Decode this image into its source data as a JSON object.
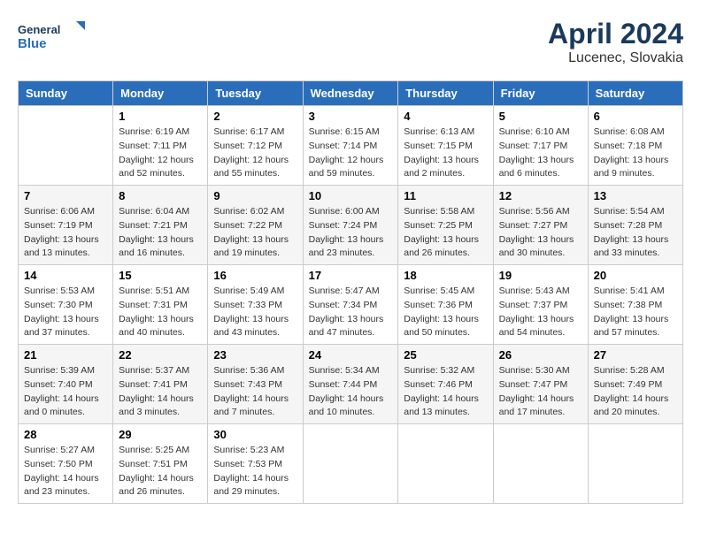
{
  "header": {
    "logo_line1": "General",
    "logo_line2": "Blue",
    "month": "April 2024",
    "location": "Lucenec, Slovakia"
  },
  "weekdays": [
    "Sunday",
    "Monday",
    "Tuesday",
    "Wednesday",
    "Thursday",
    "Friday",
    "Saturday"
  ],
  "weeks": [
    [
      {
        "day": "",
        "info": ""
      },
      {
        "day": "1",
        "info": "Sunrise: 6:19 AM\nSunset: 7:11 PM\nDaylight: 12 hours\nand 52 minutes."
      },
      {
        "day": "2",
        "info": "Sunrise: 6:17 AM\nSunset: 7:12 PM\nDaylight: 12 hours\nand 55 minutes."
      },
      {
        "day": "3",
        "info": "Sunrise: 6:15 AM\nSunset: 7:14 PM\nDaylight: 12 hours\nand 59 minutes."
      },
      {
        "day": "4",
        "info": "Sunrise: 6:13 AM\nSunset: 7:15 PM\nDaylight: 13 hours\nand 2 minutes."
      },
      {
        "day": "5",
        "info": "Sunrise: 6:10 AM\nSunset: 7:17 PM\nDaylight: 13 hours\nand 6 minutes."
      },
      {
        "day": "6",
        "info": "Sunrise: 6:08 AM\nSunset: 7:18 PM\nDaylight: 13 hours\nand 9 minutes."
      }
    ],
    [
      {
        "day": "7",
        "info": "Sunrise: 6:06 AM\nSunset: 7:19 PM\nDaylight: 13 hours\nand 13 minutes."
      },
      {
        "day": "8",
        "info": "Sunrise: 6:04 AM\nSunset: 7:21 PM\nDaylight: 13 hours\nand 16 minutes."
      },
      {
        "day": "9",
        "info": "Sunrise: 6:02 AM\nSunset: 7:22 PM\nDaylight: 13 hours\nand 19 minutes."
      },
      {
        "day": "10",
        "info": "Sunrise: 6:00 AM\nSunset: 7:24 PM\nDaylight: 13 hours\nand 23 minutes."
      },
      {
        "day": "11",
        "info": "Sunrise: 5:58 AM\nSunset: 7:25 PM\nDaylight: 13 hours\nand 26 minutes."
      },
      {
        "day": "12",
        "info": "Sunrise: 5:56 AM\nSunset: 7:27 PM\nDaylight: 13 hours\nand 30 minutes."
      },
      {
        "day": "13",
        "info": "Sunrise: 5:54 AM\nSunset: 7:28 PM\nDaylight: 13 hours\nand 33 minutes."
      }
    ],
    [
      {
        "day": "14",
        "info": "Sunrise: 5:53 AM\nSunset: 7:30 PM\nDaylight: 13 hours\nand 37 minutes."
      },
      {
        "day": "15",
        "info": "Sunrise: 5:51 AM\nSunset: 7:31 PM\nDaylight: 13 hours\nand 40 minutes."
      },
      {
        "day": "16",
        "info": "Sunrise: 5:49 AM\nSunset: 7:33 PM\nDaylight: 13 hours\nand 43 minutes."
      },
      {
        "day": "17",
        "info": "Sunrise: 5:47 AM\nSunset: 7:34 PM\nDaylight: 13 hours\nand 47 minutes."
      },
      {
        "day": "18",
        "info": "Sunrise: 5:45 AM\nSunset: 7:36 PM\nDaylight: 13 hours\nand 50 minutes."
      },
      {
        "day": "19",
        "info": "Sunrise: 5:43 AM\nSunset: 7:37 PM\nDaylight: 13 hours\nand 54 minutes."
      },
      {
        "day": "20",
        "info": "Sunrise: 5:41 AM\nSunset: 7:38 PM\nDaylight: 13 hours\nand 57 minutes."
      }
    ],
    [
      {
        "day": "21",
        "info": "Sunrise: 5:39 AM\nSunset: 7:40 PM\nDaylight: 14 hours\nand 0 minutes."
      },
      {
        "day": "22",
        "info": "Sunrise: 5:37 AM\nSunset: 7:41 PM\nDaylight: 14 hours\nand 3 minutes."
      },
      {
        "day": "23",
        "info": "Sunrise: 5:36 AM\nSunset: 7:43 PM\nDaylight: 14 hours\nand 7 minutes."
      },
      {
        "day": "24",
        "info": "Sunrise: 5:34 AM\nSunset: 7:44 PM\nDaylight: 14 hours\nand 10 minutes."
      },
      {
        "day": "25",
        "info": "Sunrise: 5:32 AM\nSunset: 7:46 PM\nDaylight: 14 hours\nand 13 minutes."
      },
      {
        "day": "26",
        "info": "Sunrise: 5:30 AM\nSunset: 7:47 PM\nDaylight: 14 hours\nand 17 minutes."
      },
      {
        "day": "27",
        "info": "Sunrise: 5:28 AM\nSunset: 7:49 PM\nDaylight: 14 hours\nand 20 minutes."
      }
    ],
    [
      {
        "day": "28",
        "info": "Sunrise: 5:27 AM\nSunset: 7:50 PM\nDaylight: 14 hours\nand 23 minutes."
      },
      {
        "day": "29",
        "info": "Sunrise: 5:25 AM\nSunset: 7:51 PM\nDaylight: 14 hours\nand 26 minutes."
      },
      {
        "day": "30",
        "info": "Sunrise: 5:23 AM\nSunset: 7:53 PM\nDaylight: 14 hours\nand 29 minutes."
      },
      {
        "day": "",
        "info": ""
      },
      {
        "day": "",
        "info": ""
      },
      {
        "day": "",
        "info": ""
      },
      {
        "day": "",
        "info": ""
      }
    ]
  ]
}
